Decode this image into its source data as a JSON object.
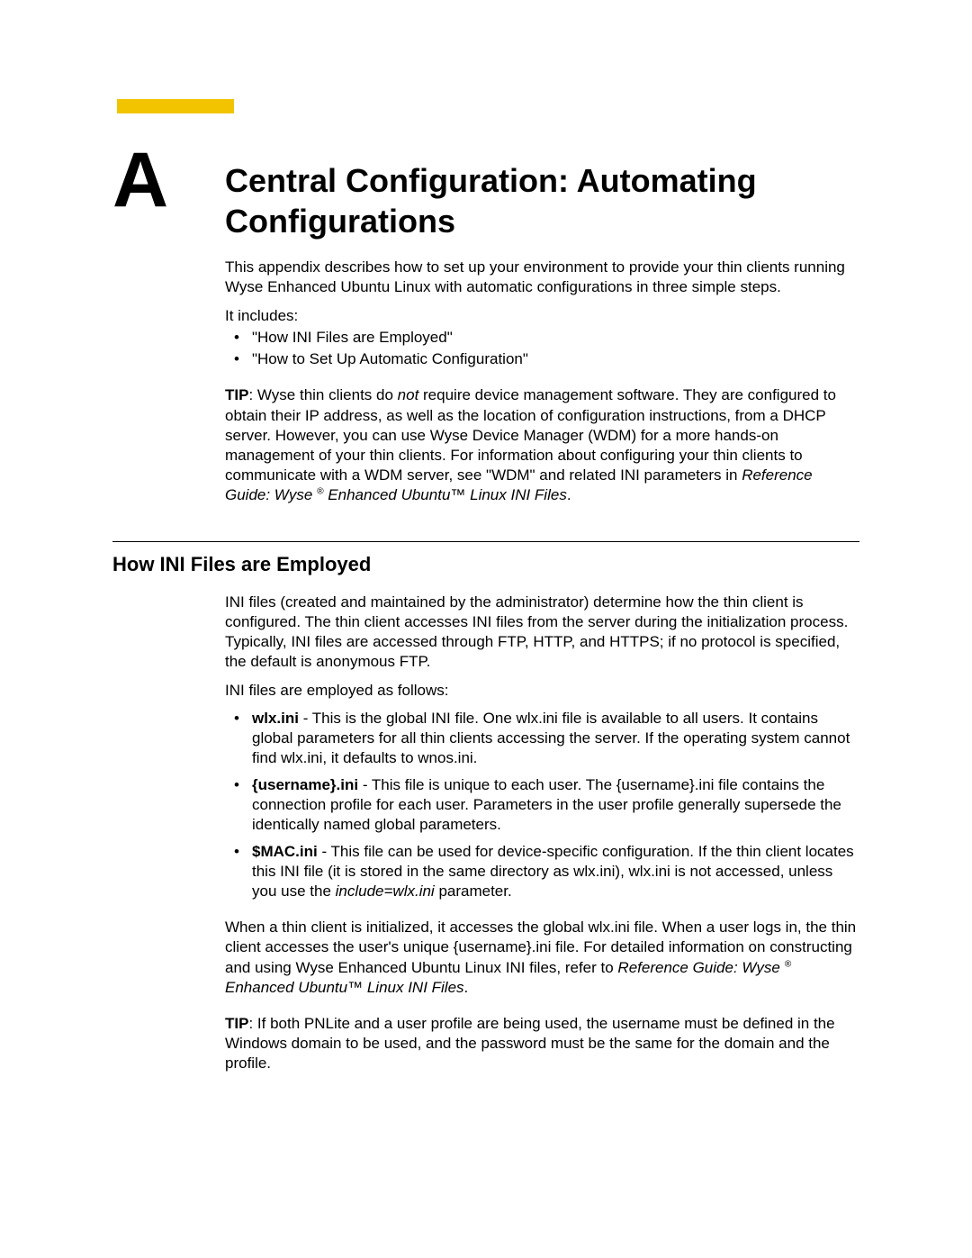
{
  "appendix_letter": "A",
  "heading": "Central Configuration: Automating Configurations",
  "intro_para": "This appendix describes how to set up your environment to provide your thin clients running Wyse Enhanced Ubuntu Linux with automatic configurations in three simple steps.",
  "includes_lead": "It includes:",
  "includes_items": [
    "\"How INI Files are Employed\"",
    "\"How to Set Up Automatic Configuration\""
  ],
  "tip_label": "TIP",
  "tip1_before_not": ": Wyse thin clients do ",
  "tip1_not": "not",
  "tip1_after_not": " require device management software. They are configured to obtain their IP address, as well as the location of configuration instructions, from a DHCP server. However, you can use Wyse Device Manager (WDM) for a more hands-on management of your thin clients. For information about configuring your thin clients to communicate with a WDM server, see \"WDM\" and related INI parameters in ",
  "ref_guide_a": "Reference Guide: Wyse",
  "reg_mark": "®",
  "ref_guide_b": " Enhanced Ubuntu™ Linux INI Files",
  "period": ".",
  "section2_heading": "How INI Files are Employed",
  "section2_para1": "INI files (created and maintained by the administrator) determine how the thin client is configured. The thin client accesses INI files from the server during the initialization process. Typically, INI files are accessed through FTP, HTTP, and HTTPS; if no protocol is specified, the default is anonymous FTP.",
  "section2_lead": "INI files are employed as follows:",
  "ini_items": [
    {
      "name": "wlx.ini",
      "desc": " - This is the global INI file. One wlx.ini file is available to all users. It contains global parameters for all thin clients accessing the server. If the operating system cannot find wlx.ini, it defaults to wnos.ini."
    },
    {
      "name": "{username}.ini",
      "desc": " - This file is unique to each user. The {username}.ini file contains the connection profile for each user. Parameters in the user profile generally supersede the identically named global parameters."
    },
    {
      "name": "$MAC.ini",
      "desc_before": " - This file can be used for device-specific configuration. If the thin client locates this INI file (it is stored in the same directory as wlx.ini), wlx.ini is not accessed, unless you use the ",
      "param": "include=wlx.ini",
      "desc_after": " parameter."
    }
  ],
  "section2_para3_a": "When a thin client is initialized, it accesses the global wlx.ini file. When a user logs in, the thin client accesses the user's unique {username}.ini file. For detailed information on constructing and using Wyse Enhanced Ubuntu Linux INI files, refer to ",
  "tip2_body": ": If both PNLite and a user profile are being used, the username must be defined in the Windows domain to be used, and the password must be the same for the domain and the profile."
}
